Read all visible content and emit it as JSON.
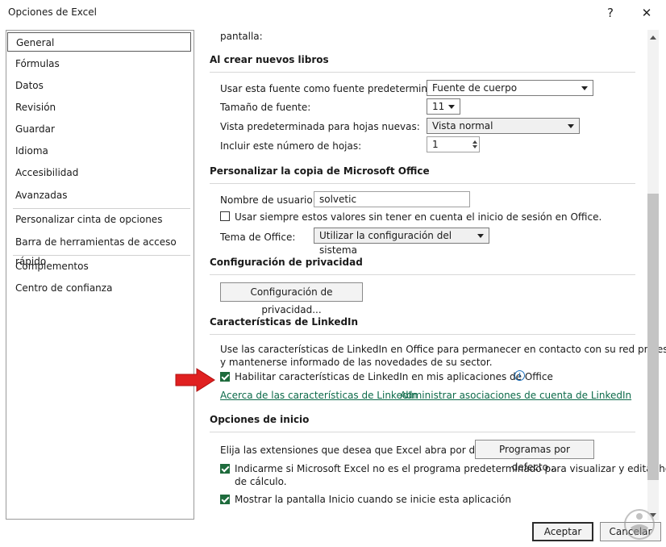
{
  "window": {
    "title": "Opciones de Excel",
    "help": "?",
    "close": "✕"
  },
  "sidebar": {
    "items": [
      {
        "label": "General",
        "selected": true
      },
      {
        "label": "Fórmulas"
      },
      {
        "label": "Datos"
      },
      {
        "label": "Revisión"
      },
      {
        "label": "Guardar"
      },
      {
        "label": "Idioma"
      },
      {
        "label": "Accesibilidad"
      },
      {
        "label": "Avanzadas"
      },
      {
        "label": "Personalizar cinta de opciones"
      },
      {
        "label": "Barra de herramientas de acceso rápido"
      },
      {
        "label": "Complementos"
      },
      {
        "label": "Centro de confianza"
      }
    ]
  },
  "main": {
    "partial_label": "pantalla:",
    "new_books": {
      "heading": "Al crear nuevos libros",
      "font_label": "Usar esta fuente como fuente predeterminada:",
      "font_value": "Fuente de cuerpo",
      "size_label": "Tamaño de fuente:",
      "size_value": "11",
      "view_label": "Vista predeterminada para hojas nuevas:",
      "view_value": "Vista normal",
      "sheets_label": "Incluir este número de hojas:",
      "sheets_value": "1"
    },
    "personalize": {
      "heading": "Personalizar la copia de Microsoft Office",
      "username_label": "Nombre de usuario:",
      "username_value": "solvetic",
      "always_label": "Usar siempre estos valores sin tener en cuenta el inicio de sesión en Office.",
      "always_checked": false,
      "theme_label": "Tema de Office:",
      "theme_value": "Utilizar la configuración del sistema"
    },
    "privacy": {
      "heading": "Configuración de privacidad",
      "button": "Configuración de privacidad..."
    },
    "linkedin": {
      "heading": "Características de LinkedIn",
      "desc_line1": "Use las características de LinkedIn en Office para permanecer en contacto con su red profesional",
      "desc_line2": "y mantenerse informado de las novedades de su sector.",
      "enable_label": "Habilitar características de LinkedIn en mis aplicaciones de Office",
      "enable_checked": true,
      "link_about": "Acerca de las características de LinkedIn",
      "link_manage": "Administrar asociaciones de cuenta de LinkedIn"
    },
    "startup": {
      "heading": "Opciones de inicio",
      "ext_label": "Elija las extensiones que desea que Excel abra por defecto:",
      "ext_button": "Programas por defecto...",
      "notify_line1": "Indicarme si Microsoft Excel no es el programa predeterminado para visualizar y editar hojas",
      "notify_line2": "de cálculo.",
      "notify_checked": true,
      "show_start_label": "Mostrar la pantalla Inicio cuando se inicie esta aplicación",
      "show_start_checked": true
    }
  },
  "footer": {
    "ok": "Aceptar",
    "cancel": "Cancelar"
  },
  "colors": {
    "accent_green": "#1e6b3c",
    "link_green": "#0d6b4a",
    "arrow_red": "#e02020"
  }
}
